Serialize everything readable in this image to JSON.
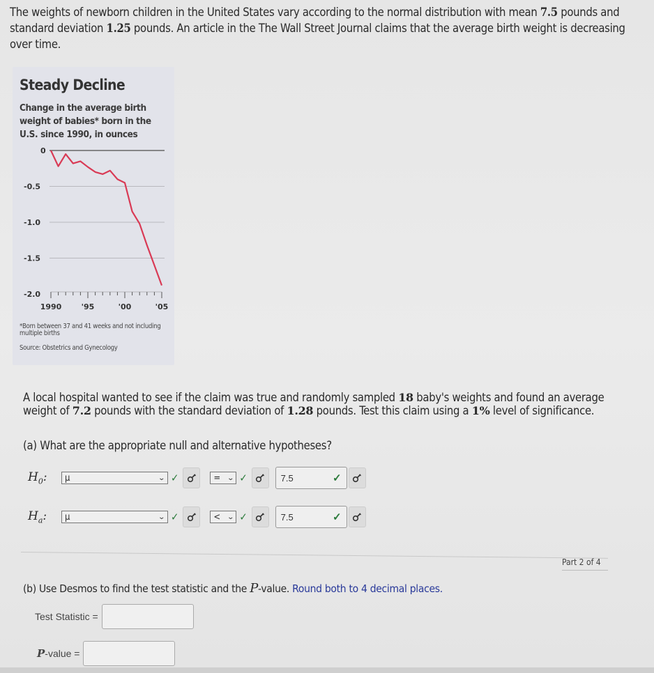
{
  "intro": {
    "t1": "The weights of newborn children in the United States vary according to the normal distribution with mean ",
    "mean": "7.5",
    "t2": " pounds and standard deviation ",
    "sd": "1.25",
    "t3": " pounds. An article in the The Wall Street Journal claims that the average birth weight is decreasing over time."
  },
  "chart_data": {
    "type": "line",
    "title": "Steady Decline",
    "subtitle": "Change in the average birth weight of babies* born in the U.S. since 1990, in ounces",
    "x": [
      1990,
      1991,
      1992,
      1993,
      1994,
      1995,
      1996,
      1997,
      1998,
      1999,
      2000,
      2001,
      2002,
      2003,
      2004,
      2005
    ],
    "series": [
      {
        "name": "Change in average birth weight (oz)",
        "color": "#d93a55",
        "values": [
          0,
          -0.22,
          -0.05,
          -0.18,
          -0.15,
          -0.23,
          -0.3,
          -0.33,
          -0.28,
          -0.4,
          -0.45,
          -0.85,
          -1.02,
          -1.32,
          -1.6,
          -1.88
        ]
      }
    ],
    "yticks": [
      "0",
      "-0.5",
      "-1.0",
      "-1.5",
      "-2.0"
    ],
    "ytick_values": [
      0,
      -0.5,
      -1.0,
      -1.5,
      -2.0
    ],
    "xticks": [
      "1990",
      "'95",
      "'00",
      "'05"
    ],
    "xtick_values": [
      1990,
      1995,
      2000,
      2005
    ],
    "ylim": [
      -2.0,
      0
    ],
    "xlim": [
      1990,
      2005
    ],
    "grid": true,
    "xlabel": "",
    "ylabel": "",
    "footnote": "*Born between 37 and 41 weeks and not including multiple births",
    "source": "Source: Obstetrics and Gynecology"
  },
  "para2": {
    "t1": "A local hospital wanted to see if the claim was true and randomly sampled ",
    "n": "18",
    "t2": " baby's weights and found an average weight of ",
    "xbar": "7.2",
    "t3": " pounds with the standard deviation of ",
    "s": "1.28",
    "t4": " pounds. Test this claim using a ",
    "alpha": "1%",
    "t5": " level of significance."
  },
  "part_a": {
    "question": "(a) What are the appropriate null and alternative hypotheses?",
    "h0": {
      "label": "H",
      "sub": "0",
      "param": "μ",
      "operator": "=",
      "value": "7.5"
    },
    "ha": {
      "label": "H",
      "sub": "a",
      "param": "μ",
      "operator": "<",
      "value": "7.5"
    },
    "check": "✓",
    "chevron": "⌄"
  },
  "progress": {
    "part_label": "Part 2 of 4"
  },
  "part_b": {
    "t1": "(b) Use Desmos to find the test statistic and the ",
    "p": "P",
    "t2": "-value. ",
    "t3": "Round both to 4 decimal places.",
    "test_stat_label": "Test Statistic =",
    "test_stat_value": "",
    "pvalue_p": "P",
    "pvalue_label": "-value =",
    "pvalue_value": ""
  }
}
